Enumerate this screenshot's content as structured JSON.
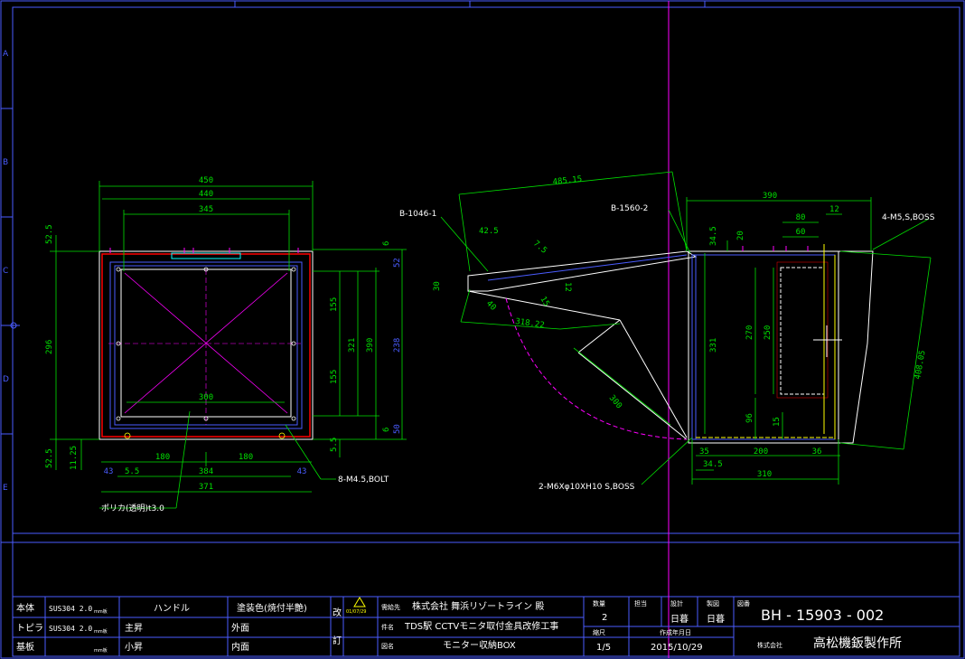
{
  "front_view": {
    "dims": {
      "w450": "450",
      "w440": "440",
      "w345": "345",
      "w300": "300",
      "w180a": "180",
      "w384": "384",
      "w180b": "180",
      "w43a": "43",
      "w5_5": "5.5",
      "w43b": "43",
      "w371": "371",
      "h52_5a": "52.5",
      "h296": "296",
      "h52_5b": "52.5",
      "h11_25": "11.25",
      "r6a": "6",
      "r52": "52",
      "r155a": "155",
      "r321": "321",
      "r155b": "155",
      "r390": "390",
      "r238": "238",
      "r6b": "6",
      "r50": "50",
      "r5_5": "5.5"
    },
    "notes": {
      "bolt": "8-M4.5,BOLT",
      "poly": "ポリカ(透明)t3.0"
    }
  },
  "side_view": {
    "dims": {
      "d485": "485.15",
      "d42_5": "42.5",
      "d7_5": "7.5",
      "d30": "30",
      "d12": "12",
      "d15": "15",
      "d40": "40",
      "d318": "318.22",
      "d300": "300",
      "d390": "390",
      "d34_5": "34.5",
      "d20": "20",
      "d80": "80",
      "d60": "60",
      "d12b": "12",
      "d331": "331",
      "d270": "270",
      "d250": "250",
      "d96": "96",
      "d15b": "15",
      "d35": "35",
      "d34_5b": "34.5",
      "d200": "200",
      "d36": "36",
      "d310": "310",
      "d408": "408.05"
    },
    "labels": {
      "b1046": "B-1046-1",
      "b1560": "B-1560-2",
      "boss4": "4-M5,S,BOSS",
      "boss2": "2-M6Xφ10XH10 S,BOSS"
    }
  },
  "ruler_letters": [
    "A",
    "B",
    "C",
    "D",
    "E"
  ],
  "title_block": {
    "mat": [
      {
        "part": "本体",
        "spec": "SUS304 2.0"
      },
      {
        "part": "トピラ",
        "spec": "SUS304 2.0"
      },
      {
        "part": "基板",
        "spec": ""
      }
    ],
    "mat_unit": "mm板",
    "handle": "ハンドル",
    "lift_up": "主昇",
    "lift_down": "小昇",
    "paint_head": "塗装色(焼付半艶)",
    "outside": "外面",
    "inside": "内面",
    "rev1": "改",
    "rev2": "訂",
    "rev_date": "01/07/29",
    "customer_label": "需給先",
    "customer": "株式会社 舞浜リゾートライン 殿",
    "project_label": "件名",
    "project": "TDS駅 CCTVモニタ取付金具改修工事",
    "drawing_label": "図名",
    "drawing": "モニター収納BOX",
    "qty_label": "数量",
    "qty": "2",
    "scale_label": "縮尺",
    "scale": "1/5",
    "resp_label": "担当",
    "design_label": "設計",
    "design": "日暮",
    "draw_label": "製図",
    "draw": "日暮",
    "date_label": "作成年月日",
    "date": "2015/10/29",
    "no_label": "図番",
    "no": "BH - 15903 - 002",
    "company_label": "株式会社",
    "company": "高松機鈑製作所"
  },
  "colors": {
    "bg": "#000000",
    "green": "#00e000",
    "white": "#ffffff",
    "magenta": "#ff00ff",
    "red": "#ff0000",
    "blue": "#4a5cff",
    "cyan": "#00ffff",
    "yellow": "#ffff00"
  }
}
